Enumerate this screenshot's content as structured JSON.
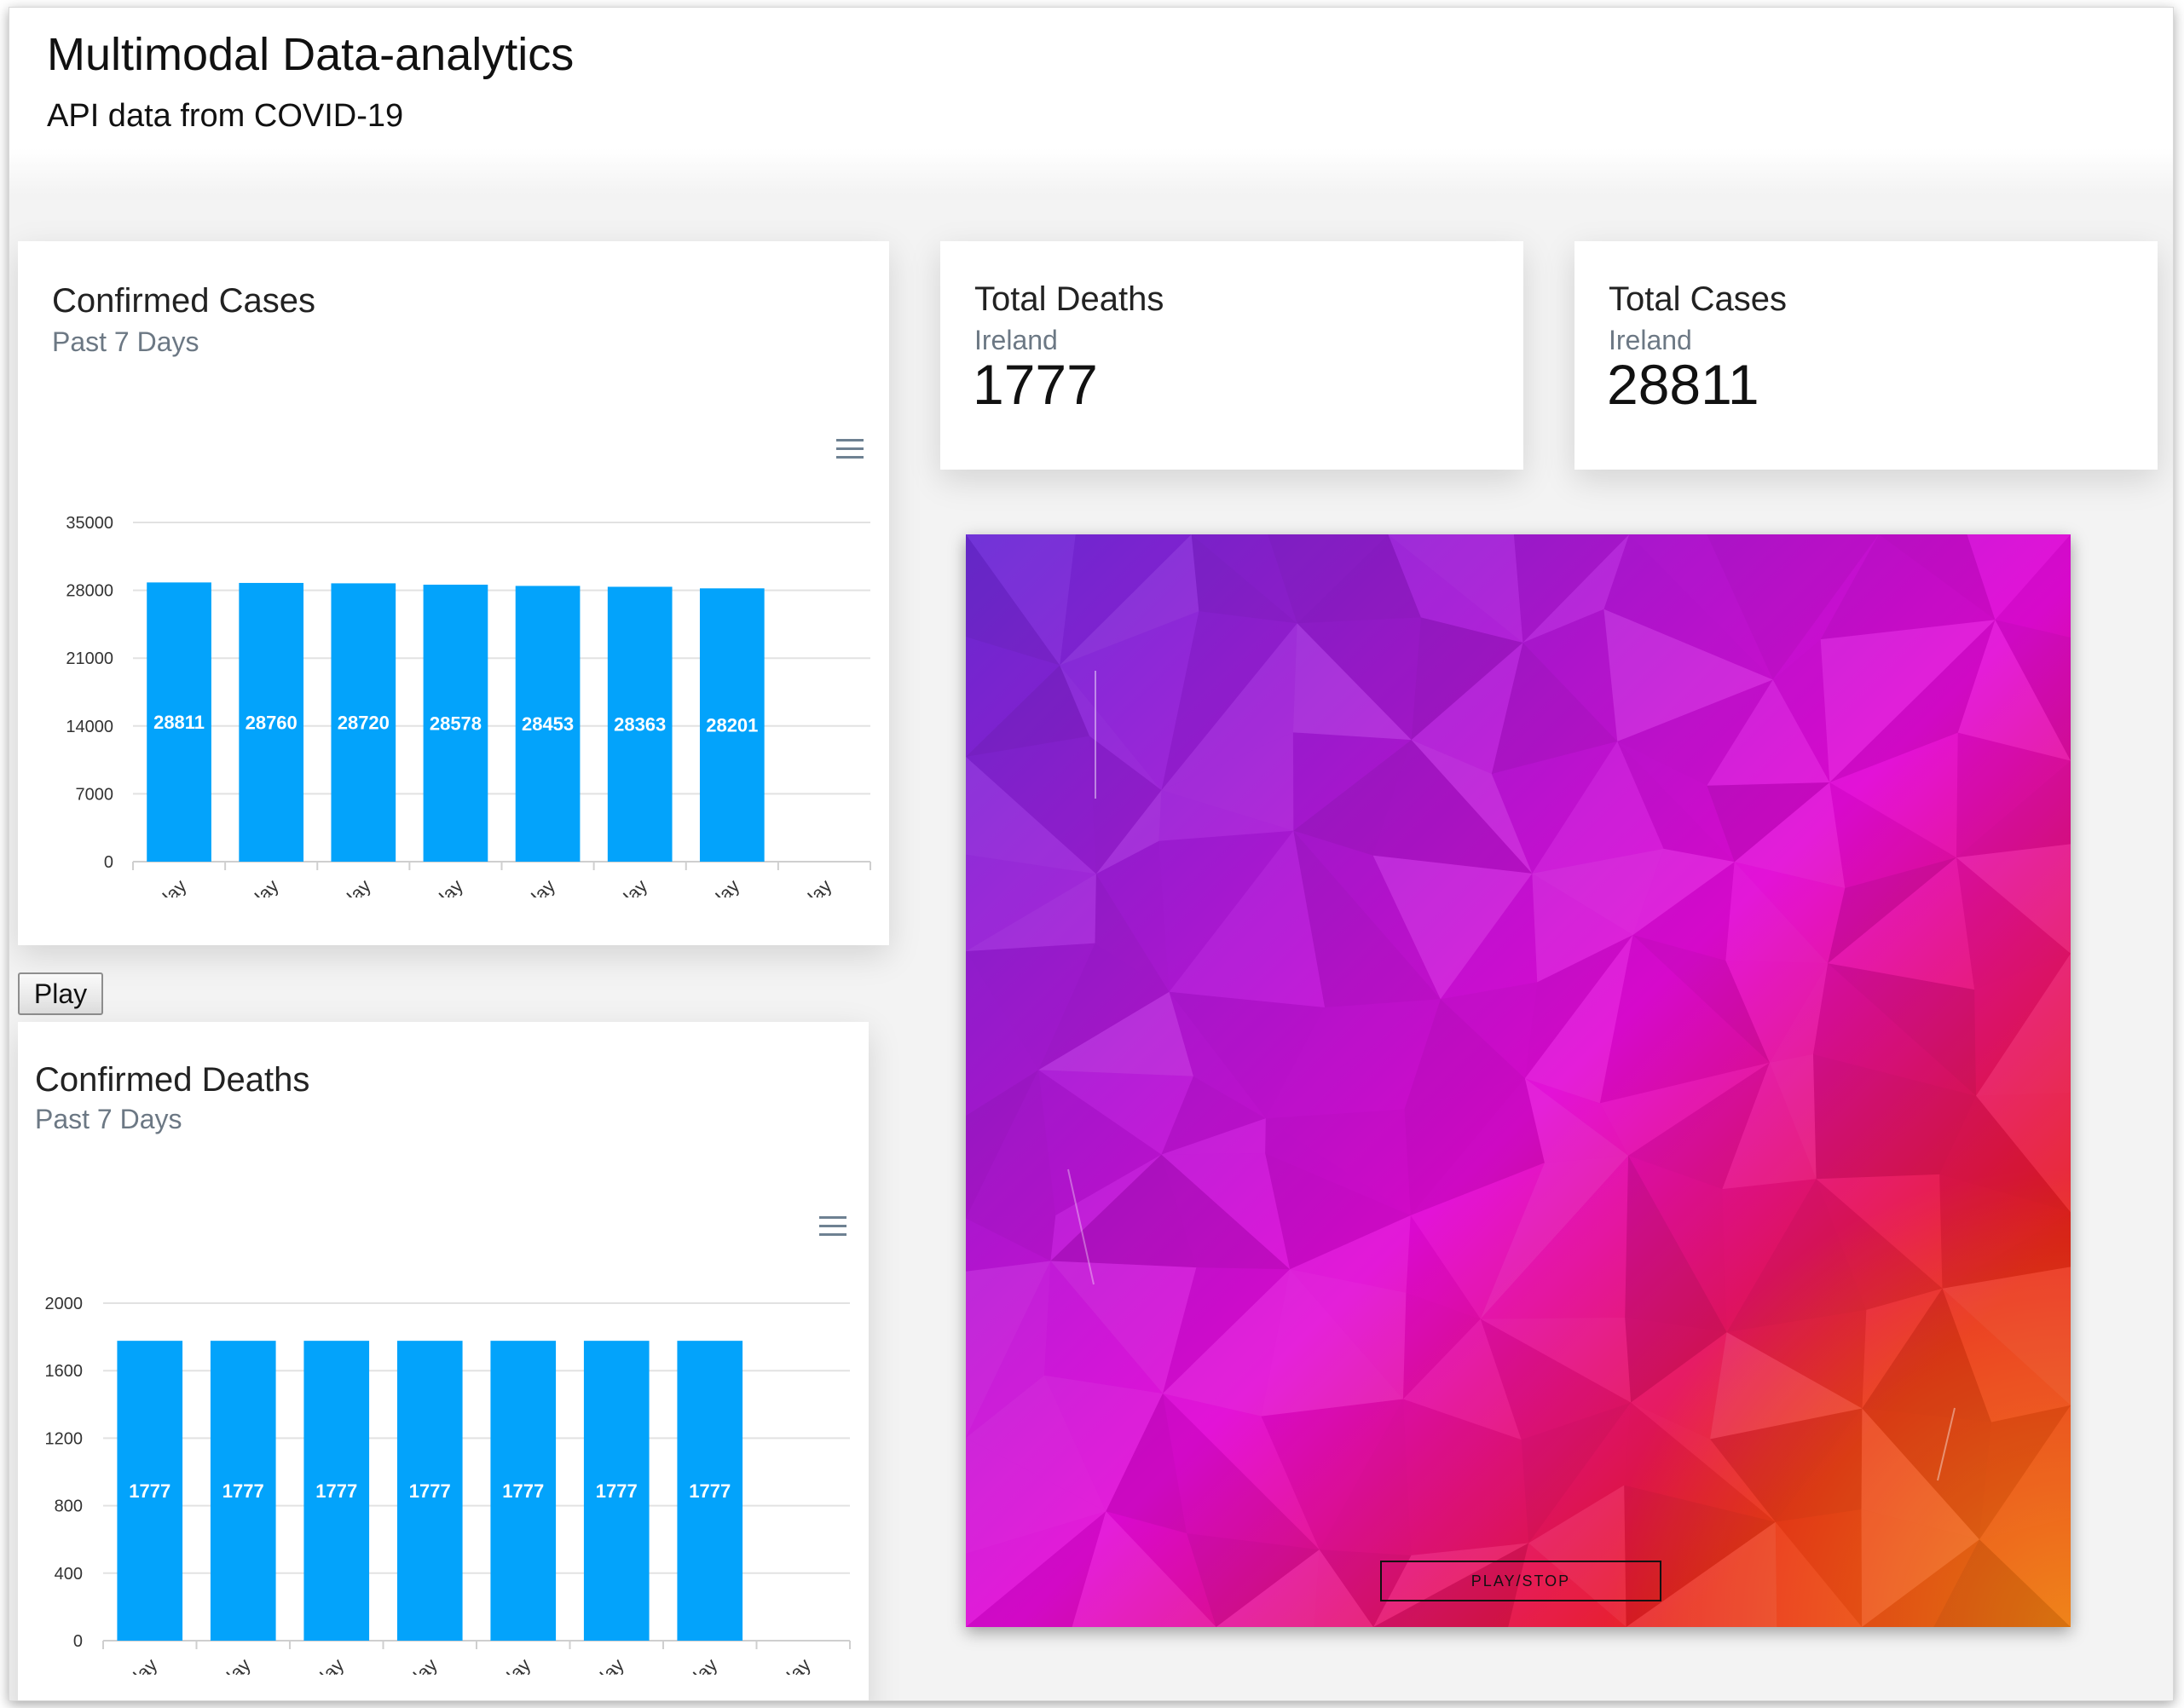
{
  "header": {
    "title": "Multimodal Data-analytics",
    "subtitle": "API data from COVID-19"
  },
  "cases_chart": {
    "title": "Confirmed Cases",
    "subtitle": "Past 7 Days",
    "menu_icon": "hamburger-menu-icon"
  },
  "deaths_chart": {
    "title": "Confirmed Deaths",
    "subtitle": "Past 7 Days",
    "menu_icon": "hamburger-menu-icon"
  },
  "total_deaths": {
    "title": "Total Deaths",
    "region": "Ireland",
    "value": "1777"
  },
  "total_cases": {
    "title": "Total Cases",
    "region": "Ireland",
    "value": "28811"
  },
  "controls": {
    "play_label": "Play",
    "play_stop_label": "PLAY/STOP"
  },
  "colors": {
    "bar": "#03a3fb",
    "art_top_left": "#6a2bd6",
    "art_middle": "#e20ad6",
    "art_bottom_right": "#e81a1a",
    "art_corner": "#f08a10"
  },
  "chart_data": [
    {
      "type": "bar",
      "categories": [
        "Tuesday",
        "Wednesday",
        "Thursday",
        "Friday",
        "Saturday",
        "Sunday",
        "Monday",
        "Tuesday"
      ],
      "values": [
        28811,
        28760,
        28720,
        28578,
        28453,
        28363,
        28201
      ],
      "data_labels": [
        "28811",
        "28760",
        "28720",
        "28578",
        "28453",
        "28363",
        "28201"
      ],
      "yticks": [
        "0",
        "7000",
        "14000",
        "21000",
        "28000",
        "35000"
      ],
      "ylim": [
        0,
        35000
      ],
      "grid": true
    },
    {
      "type": "bar",
      "categories": [
        "Tuesday",
        "Wednesday",
        "Thursday",
        "Friday",
        "Saturday",
        "Sunday",
        "Monday",
        "Tuesday"
      ],
      "values": [
        1777,
        1777,
        1777,
        1777,
        1777,
        1777,
        1777
      ],
      "data_labels": [
        "1777",
        "1777",
        "1777",
        "1777",
        "1777",
        "1777",
        "1777"
      ],
      "yticks": [
        "0",
        "400",
        "800",
        "1200",
        "1600",
        "2000"
      ],
      "ylim": [
        0,
        2000
      ],
      "grid": true
    }
  ]
}
